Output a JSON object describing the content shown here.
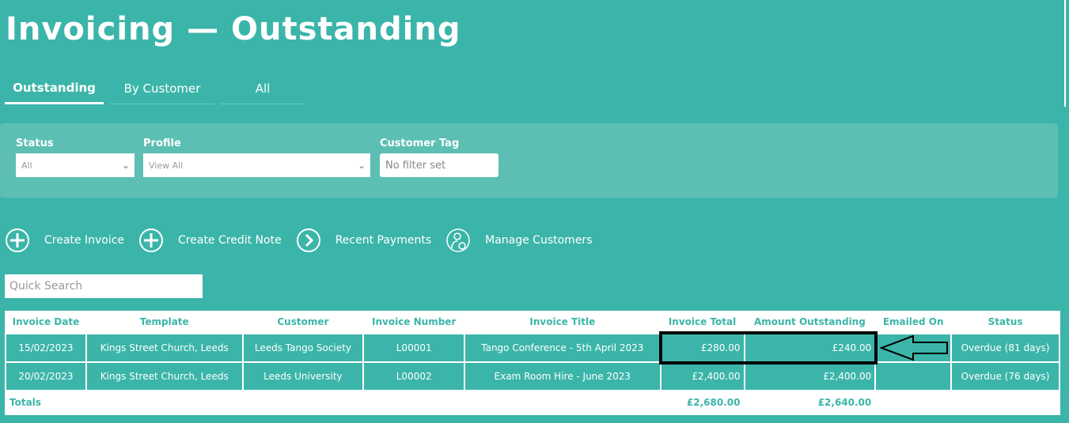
{
  "title": "Invoicing — Outstanding",
  "tabs": [
    "Outstanding",
    "By Customer",
    "All"
  ],
  "filters": {
    "status_label": "Status",
    "status_value": "All",
    "profile_label": "Profile",
    "profile_value": "View All",
    "tag_label": "Customer Tag",
    "tag_placeholder": "No filter set"
  },
  "actions": [
    "Create Invoice",
    "Create Credit Note",
    "Recent Payments",
    "Manage Customers"
  ],
  "search_placeholder": "Quick Search",
  "table": {
    "headers": [
      "Invoice Date",
      "Template",
      "Customer",
      "Invoice Number",
      "Invoice Title",
      "Invoice Total",
      "Amount Outstanding",
      "Emailed On",
      "Status"
    ],
    "rows": [
      [
        "15/02/2023",
        "Kings Street Church, Leeds",
        "Leeds Tango Society",
        "L00001",
        "Tango Conference - 5th April 2023",
        "£280.00",
        "£240.00",
        "",
        "Overdue (81 days)"
      ],
      [
        "20/02/2023",
        "Kings Street Church, Leeds",
        "Leeds University",
        "L00002",
        "Exam Room Hire - June 2023",
        "£2,400.00",
        "£2,400.00",
        "",
        "Overdue (76 days)"
      ]
    ],
    "totals_label": "Totals",
    "total_invoice": "£2,680.00",
    "total_outstanding": "£2,640.00"
  }
}
